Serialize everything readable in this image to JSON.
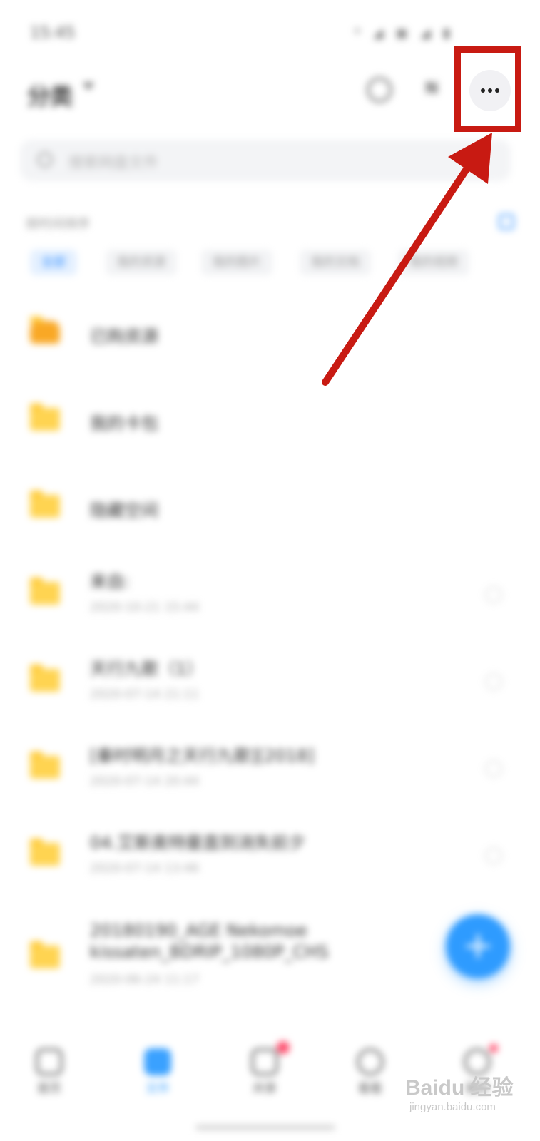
{
  "status_bar": {
    "time": "15:45",
    "right_icons": "* ◢ ▣ ◢ ▮"
  },
  "header": {
    "title": "分类",
    "more_button_label": "...",
    "sort_label": "N"
  },
  "search": {
    "placeholder": "搜索网盘文件"
  },
  "sort_row": {
    "label": "按时间排序"
  },
  "chips": [
    {
      "label": "全部",
      "active": true
    },
    {
      "label": "我的资源"
    },
    {
      "label": "我的图片"
    },
    {
      "label": "我的文档"
    },
    {
      "label": "我的视频"
    }
  ],
  "files": [
    {
      "name": "已购资源",
      "date": ""
    },
    {
      "name": "我的卡包",
      "date": ""
    },
    {
      "name": "隐藏空间",
      "date": ""
    },
    {
      "name": "来自:",
      "date": "2020-10-21 15:44"
    },
    {
      "name": "天行九歌（1）",
      "date": "2020-07-14 21:11"
    },
    {
      "name": "[秦时明月之天行九歌][2018]",
      "date": "2020-07-14 20:44"
    },
    {
      "name": "04.艾斯奥特曼直到消失前夕",
      "date": "2020-07-14 13:46"
    },
    {
      "name": "20180190_AGE Nekomoe kissaten_BDRIP_1080P_CHS",
      "date": "2020-06-24 11:17"
    }
  ],
  "bottom_nav": [
    {
      "label": "首页"
    },
    {
      "label": "文件",
      "active": true
    },
    {
      "label": "共享"
    },
    {
      "label": "看看"
    },
    {
      "label": "我的"
    }
  ],
  "watermark": {
    "logo": "Baidu 经验",
    "sub": "jingyan.baidu.com"
  },
  "colors": {
    "accent": "#2e9bff",
    "annotation": "#c81a12",
    "folder": "#ffd451"
  }
}
